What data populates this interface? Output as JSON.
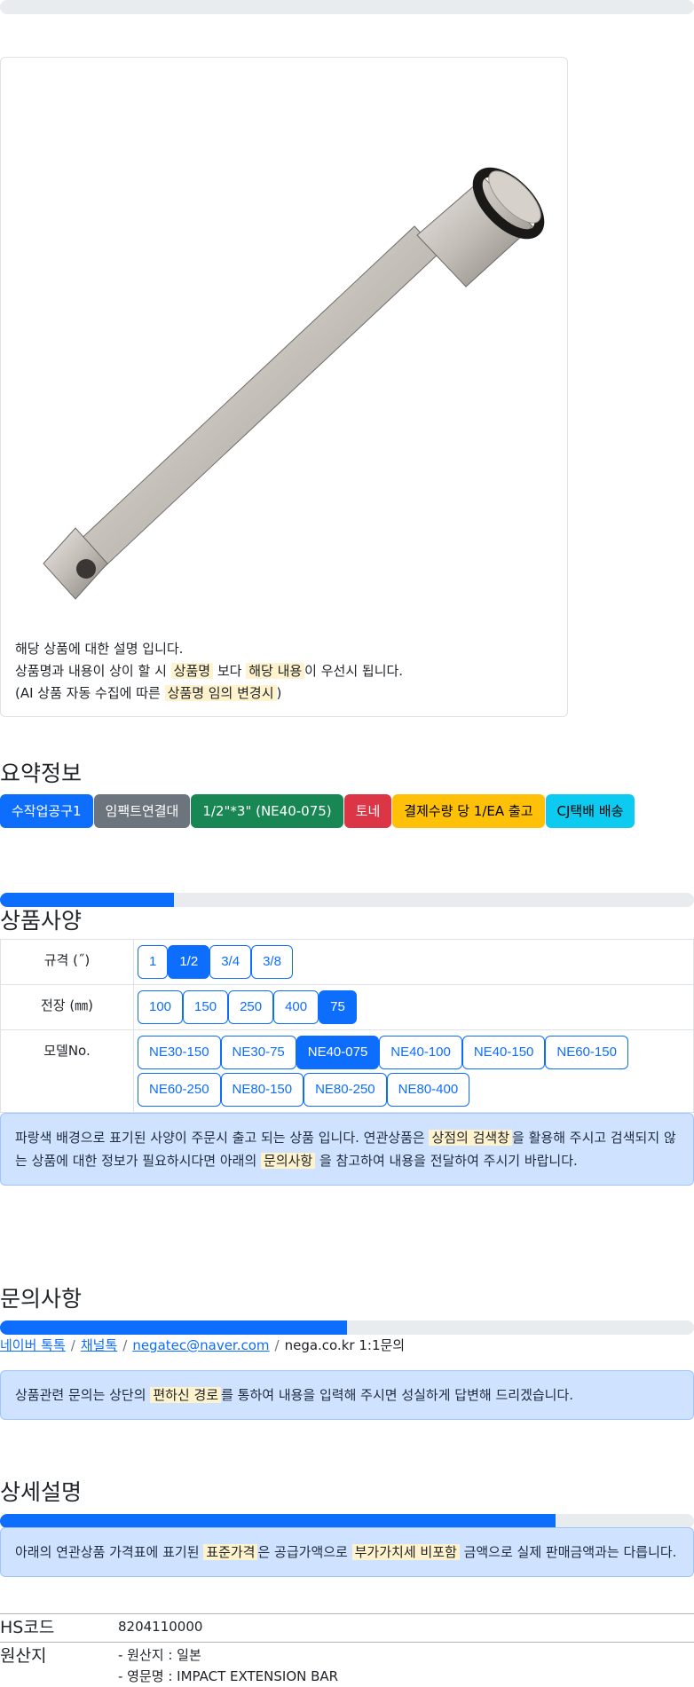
{
  "top_progress": {
    "value": 0
  },
  "product_card": {
    "image_alt": "impact extension bar",
    "note_line1": "해당 상품에 대한 설명 입니다.",
    "note_line2_a": "상품명과 내용이 상이 할 시 ",
    "note_line2_mark1": "상품명",
    "note_line2_b": " 보다 ",
    "note_line2_mark2": "해당 내용",
    "note_line2_c": "이 우선시 됩니다.",
    "note_line3_a": "(AI 상품 자동 수집에 따른 ",
    "note_line3_mark": "상품명 임의 변경시",
    "note_line3_b": ")"
  },
  "summary": {
    "title": "요약정보",
    "badges": [
      {
        "label": "수작업공구1",
        "color": "#0d6efd"
      },
      {
        "label": "임팩트연결대",
        "color": "#6c757d"
      },
      {
        "label": "1/2\"*3\" (NE40-075)",
        "color": "#198754"
      },
      {
        "label": "토네",
        "color": "#dc3545"
      },
      {
        "label": "결제수량 당 1/EA 출고",
        "color": "#ffc107"
      },
      {
        "label": "CJ택배 배송",
        "color": "#0dcaf0"
      }
    ]
  },
  "spec": {
    "progress": 25,
    "title": "상품사양",
    "rows": [
      {
        "label": "규격 (˝)",
        "options": [
          "1",
          "1/2",
          "3/4",
          "3/8"
        ],
        "selected": "1/2"
      },
      {
        "label": "전장 (㎜)",
        "options": [
          "100",
          "150",
          "250",
          "400",
          "75"
        ],
        "selected": "75"
      },
      {
        "label": "모델No.",
        "options": [
          "NE30-150",
          "NE30-75",
          "NE40-075",
          "NE40-100",
          "NE40-150",
          "NE60-150",
          "NE60-250",
          "NE80-150",
          "NE80-250",
          "NE80-400"
        ],
        "selected": "NE40-075"
      }
    ],
    "alert_a": "파랑색 배경으로 표기된 사양이 주문시 출고 되는 상품 입니다. 연관상품은 ",
    "alert_mark1": "상점의 검색창",
    "alert_b": "을 활용해 주시고 검색되지 않는 상품에 대한 정보가 필요하시다면 아래의 ",
    "alert_mark2": "문의사항",
    "alert_c": " 을 참고하여 내용을 전달하여 주시기 바랍니다."
  },
  "inquiry": {
    "title": "문의사항",
    "progress": 50,
    "link_naver_talk": "네이버 톡톡",
    "link_channel_talk": "채널톡",
    "link_email": "negatec@naver.com",
    "text_site": "nega.co.kr 1:1문의",
    "alert_a": "상품관련 문의는 상단의 ",
    "alert_mark": "편하신 경로",
    "alert_b": "를 통하여 내용을 입력해 주시면 성실하게 답변해 드리겠습니다."
  },
  "detail": {
    "title": "상세설명",
    "progress": 80,
    "alert_a": "아래의 연관상품 가격표에 표기된 ",
    "alert_mark1": "표준가격",
    "alert_b": "은 공급가액으로 ",
    "alert_mark2": "부가가치세 비포함",
    "alert_c": " 금액으로 실제 판매금액과는 다릅니다.",
    "hs_label": "HS코드",
    "hs_value": "8204110000",
    "origin_label": "원산지",
    "origin_line1": "- 원산지 : 일본",
    "origin_line2": "- 영문명 : IMPACT EXTENSION BAR"
  }
}
